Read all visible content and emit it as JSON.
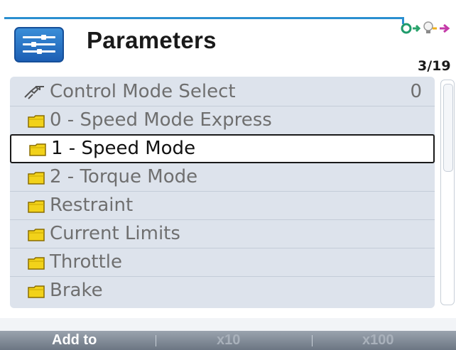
{
  "header": {
    "title": "Parameters",
    "counter": "3/19",
    "icon": "sliders-icon"
  },
  "status_bar": {
    "icons": [
      "connection-icon",
      "bulb-icon",
      "arrow-icon"
    ]
  },
  "list": {
    "items": [
      {
        "icon": "tools-icon",
        "label": "Control Mode Select",
        "value": "0",
        "selected": false
      },
      {
        "icon": "folder-icon",
        "label": "0 - Speed Mode Express",
        "selected": false
      },
      {
        "icon": "folder-icon",
        "label": "1 - Speed Mode",
        "selected": true
      },
      {
        "icon": "folder-icon",
        "label": "2 - Torque Mode",
        "selected": false
      },
      {
        "icon": "folder-icon",
        "label": "Restraint",
        "selected": false
      },
      {
        "icon": "folder-icon",
        "label": "Current Limits",
        "selected": false
      },
      {
        "icon": "folder-icon",
        "label": "Throttle",
        "selected": false
      },
      {
        "icon": "folder-icon",
        "label": "Brake",
        "selected": false
      }
    ]
  },
  "softkeys": {
    "left": "Add to",
    "middle": "x10",
    "right": "x100"
  },
  "colors": {
    "accent": "#2a8fd0",
    "list_bg": "#dde3ec",
    "folder": "#f2d21a",
    "text_dim": "#6f6f6f"
  }
}
